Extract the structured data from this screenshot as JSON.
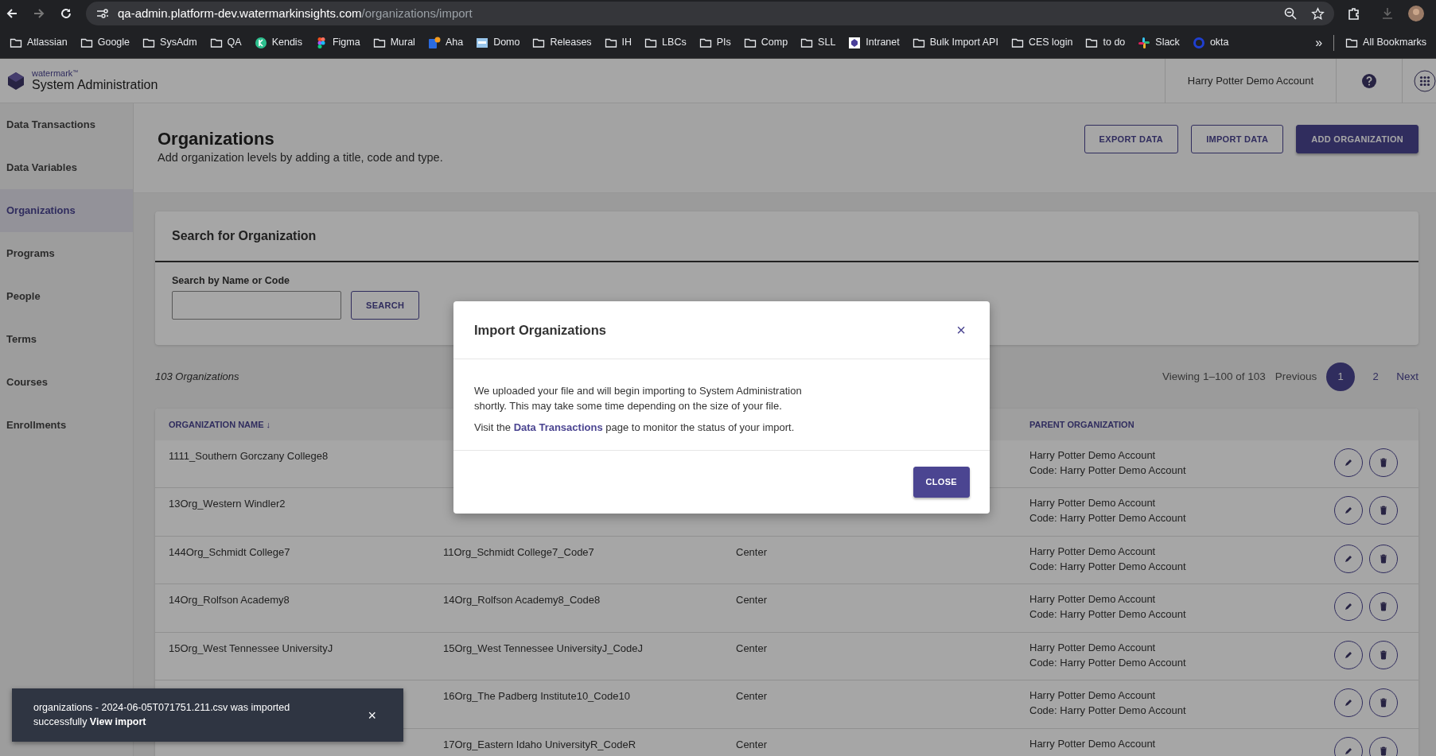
{
  "browser": {
    "url_host": "qa-admin.platform-dev.watermarkinsights.com",
    "url_path": "/organizations/import",
    "bookmarks": [
      {
        "label": "Atlassian",
        "kind": "folder"
      },
      {
        "label": "Google",
        "kind": "folder"
      },
      {
        "label": "SysAdm",
        "kind": "folder"
      },
      {
        "label": "QA",
        "kind": "folder"
      },
      {
        "label": "Kendis",
        "kind": "kendis"
      },
      {
        "label": "Figma",
        "kind": "figma"
      },
      {
        "label": "Mural",
        "kind": "folder"
      },
      {
        "label": "Aha",
        "kind": "aha"
      },
      {
        "label": "Domo",
        "kind": "domo"
      },
      {
        "label": "Releases",
        "kind": "folder"
      },
      {
        "label": "IH",
        "kind": "folder"
      },
      {
        "label": "LBCs",
        "kind": "folder"
      },
      {
        "label": "PIs",
        "kind": "folder"
      },
      {
        "label": "Comp",
        "kind": "folder"
      },
      {
        "label": "SLL",
        "kind": "folder"
      },
      {
        "label": "Intranet",
        "kind": "intranet"
      },
      {
        "label": "Bulk Import API",
        "kind": "folder"
      },
      {
        "label": "CES login",
        "kind": "folder"
      },
      {
        "label": "to do",
        "kind": "folder"
      },
      {
        "label": "Slack",
        "kind": "slack"
      },
      {
        "label": "okta",
        "kind": "okta"
      }
    ],
    "more": "»",
    "all_bookmarks": "All Bookmarks"
  },
  "header": {
    "brand": "watermark",
    "brand_mark": "™",
    "title": "System Administration",
    "account": "Harry Potter Demo Account"
  },
  "sidebar": {
    "items": [
      {
        "label": "Data Transactions",
        "selected": false
      },
      {
        "label": "Data Variables",
        "selected": false
      },
      {
        "label": "Organizations",
        "selected": true
      },
      {
        "label": "Programs",
        "selected": false
      },
      {
        "label": "People",
        "selected": false
      },
      {
        "label": "Terms",
        "selected": false
      },
      {
        "label": "Courses",
        "selected": false
      },
      {
        "label": "Enrollments",
        "selected": false
      }
    ]
  },
  "page": {
    "title": "Organizations",
    "subtitle": "Add organization levels by adding a title, code and type.",
    "buttons": [
      {
        "label": "EXPORT DATA",
        "kind": "outline"
      },
      {
        "label": "IMPORT DATA",
        "kind": "outline"
      },
      {
        "label": "ADD ORGANIZATION",
        "kind": "primary"
      }
    ]
  },
  "search": {
    "title": "Search for Organization",
    "label": "Search by Name or Code",
    "button": "SEARCH"
  },
  "count": "103 Organizations",
  "pagination": {
    "summary": "Viewing 1–100 of 103",
    "previous": "Previous",
    "pages": [
      {
        "label": "1",
        "selected": true
      },
      {
        "label": "2",
        "selected": false
      }
    ],
    "next": "Next"
  },
  "table": {
    "columns": [
      {
        "label": "ORGANIZATION NAME ↓"
      },
      {},
      {},
      {
        "label": "PARENT ORGANIZATION"
      }
    ],
    "rows": [
      {
        "name": "1111_Southern Gorczany College8",
        "parent": "Harry Potter Demo Account",
        "parent_code": "Code: Harry Potter Demo Account"
      },
      {
        "name": "13Org_Western Windler2",
        "parent": "Harry Potter Demo Account",
        "parent_code": "Code: Harry Potter Demo Account"
      },
      {
        "name": "144Org_Schmidt College7",
        "code": "11Org_Schmidt College7_Code7",
        "type": "Center",
        "parent": "Harry Potter Demo Account",
        "parent_code": "Code: Harry Potter Demo Account"
      },
      {
        "name": "14Org_Rolfson Academy8",
        "code": "14Org_Rolfson Academy8_Code8",
        "type": "Center",
        "parent": "Harry Potter Demo Account",
        "parent_code": "Code: Harry Potter Demo Account"
      },
      {
        "name": "15Org_West Tennessee UniversityJ",
        "code": "15Org_West Tennessee UniversityJ_CodeJ",
        "type": "Center",
        "parent": "Harry Potter Demo Account",
        "parent_code": "Code: Harry Potter Demo Account"
      },
      {
        "code": "16Org_The Padberg Institute10_Code10",
        "type": "Center",
        "parent": "Harry Potter Demo Account",
        "parent_code": "Code: Harry Potter Demo Account"
      },
      {
        "code": "17Org_Eastern Idaho UniversityR_CodeR",
        "type": "Center",
        "parent": "Harry Potter Demo Account"
      }
    ]
  },
  "modal": {
    "title": "Import Organizations",
    "close_icon": "×",
    "paragraph": "We uploaded your file and will begin importing to System Administration shortly. This may take some time depending on the size of your file.",
    "visit_before": "Visit the",
    "visit_link": "Data Transactions",
    "visit_after": "page to monitor the status of your import.",
    "button": "CLOSE"
  },
  "toast": {
    "message": "organizations - 2024-06-05T071751.211.csv was imported successfully",
    "link": "View import",
    "close_icon": "×"
  }
}
